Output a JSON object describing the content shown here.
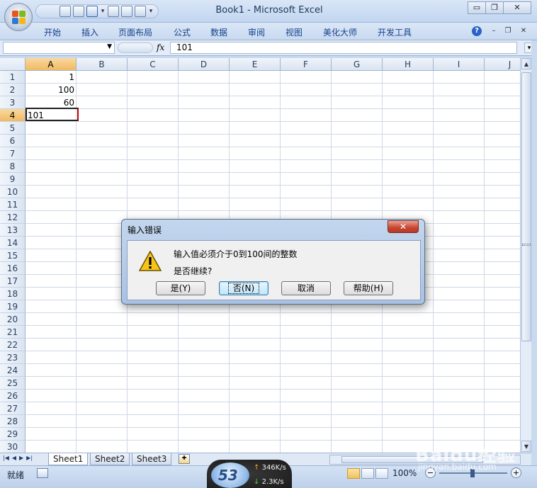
{
  "window": {
    "title": "Book1 - Microsoft Excel",
    "minimize": "▭",
    "restore": "❐",
    "close": "✕"
  },
  "ribbon": {
    "tabs": [
      "开始",
      "插入",
      "页面布局",
      "公式",
      "数据",
      "审阅",
      "视图",
      "美化大师",
      "开发工具"
    ],
    "help": "?",
    "min": "–",
    "restore": "❐",
    "close": "✕"
  },
  "formula_bar": {
    "name_box": "",
    "fx": "fx",
    "value": "101"
  },
  "grid": {
    "columns": [
      "A",
      "B",
      "C",
      "D",
      "E",
      "F",
      "G",
      "H",
      "I",
      "J"
    ],
    "selected_column": "A",
    "rows": [
      "1",
      "2",
      "3",
      "4",
      "5",
      "6",
      "7",
      "8",
      "9",
      "10",
      "11",
      "12",
      "13",
      "14",
      "15",
      "16",
      "17",
      "18",
      "19",
      "20",
      "21",
      "22",
      "23",
      "24",
      "25",
      "26",
      "27",
      "28",
      "29",
      "30"
    ],
    "selected_row": "4",
    "cells": [
      {
        "col": "A",
        "row": "1",
        "value": "1",
        "align": "right"
      },
      {
        "col": "A",
        "row": "2",
        "value": "100",
        "align": "right"
      },
      {
        "col": "A",
        "row": "3",
        "value": "60",
        "align": "right"
      },
      {
        "col": "A",
        "row": "4",
        "value": "101",
        "align": "left"
      }
    ]
  },
  "sheets": {
    "tabs": [
      "Sheet1",
      "Sheet2",
      "Sheet3"
    ],
    "active": "Sheet1"
  },
  "status_bar": {
    "status": "就绪",
    "zoom": "100%",
    "zoom_minus": "−",
    "zoom_plus": "+"
  },
  "net_widget": {
    "percent": "53",
    "up": "346K/s",
    "down": "2.3K/s"
  },
  "watermark": {
    "text": "Baidu经验",
    "sub": "jingyan.baidu.com"
  },
  "dialog": {
    "title": "输入错误",
    "close": "✕",
    "message": "输入值必须介于0到100间的整数",
    "question": "是否继续?",
    "buttons": {
      "yes": "是(Y)",
      "no": "否(N)",
      "cancel": "取消",
      "help": "帮助(H)"
    }
  },
  "colors": {
    "accent": "#15428b",
    "selected_header": "#f1b962",
    "dialog_frame": "#a9c2e3",
    "close_red": "#c9452f"
  }
}
